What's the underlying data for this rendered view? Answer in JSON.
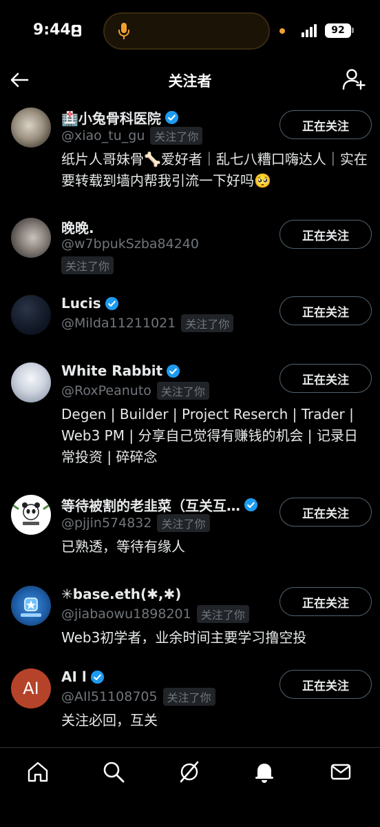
{
  "status_bar": {
    "time": "9:44",
    "battery": "92"
  },
  "header": {
    "title": "关注者"
  },
  "follow_button_label": "正在关注",
  "users": [
    {
      "name": "🏥小兔骨科医院",
      "verified": true,
      "handle": "@xiao_tu_gu",
      "follows_you": "关注了你",
      "bio": "纸片人哥妹骨🦴爱好者｜乱七八糟口嗨达人｜实在要转载到墙内帮我引流一下好吗🥺"
    },
    {
      "name": "晚晚.",
      "verified": false,
      "handle": "@w7bpukSzba84240",
      "follows_you": "关注了你",
      "bio": ""
    },
    {
      "name": "Lucis",
      "verified": true,
      "handle": "@Milda11211021",
      "follows_you": "关注了你",
      "bio": ""
    },
    {
      "name": "White Rabbit",
      "verified": true,
      "handle": "@RoxPeanuto",
      "follows_you": "关注了你",
      "bio": "Degen | Builder | Project Reserch | Trader | Web3 PM | 分享自己觉得有赚钱的机会 | 记录日常投资 | 碎碎念"
    },
    {
      "name": "等待被割的老韭菜（互关互…",
      "verified": true,
      "handle": "@pjjin574832",
      "follows_you": "关注了你",
      "bio": "已熟透，等待有缘人"
    },
    {
      "name": "✳base.eth(✱,✱)",
      "verified": false,
      "handle": "@jiabaowu1898201",
      "follows_you": "关注了你",
      "bio": "Web3初学者，业余时间主要学习撸空投"
    },
    {
      "name": "AI l",
      "verified": true,
      "handle": "@AIl51108705",
      "follows_you": "关注了你",
      "bio": "关注必回，互关",
      "avatar_text": "AI",
      "avatar_color": "#b5432a"
    }
  ],
  "nav": [
    "home-icon",
    "search-icon",
    "grok-icon",
    "notifications-icon",
    "messages-icon"
  ],
  "colors": {
    "background": "#000000",
    "verified": "#1d9bf0",
    "muted": "#71767b",
    "border": "#536471"
  }
}
